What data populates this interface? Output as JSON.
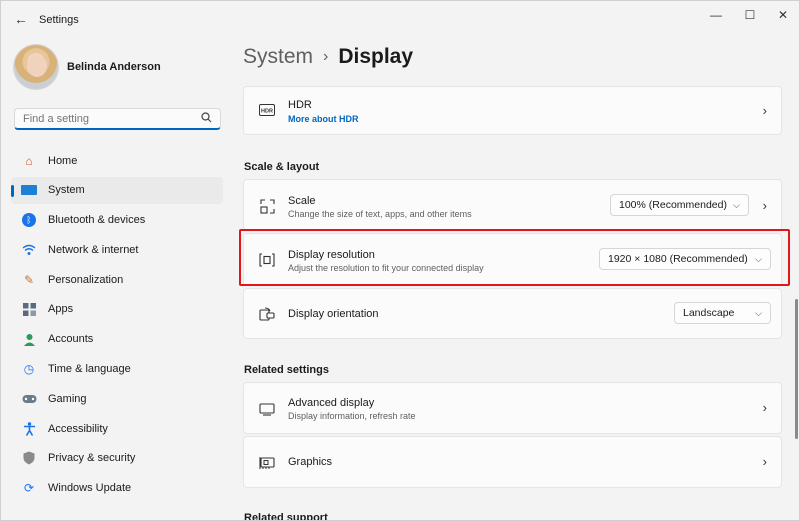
{
  "window": {
    "app_title": "Settings",
    "back_glyph": "←",
    "minimize_glyph": "—",
    "maximize_glyph": "☐",
    "close_glyph": "✕"
  },
  "profile": {
    "name": "Belinda Anderson"
  },
  "search": {
    "placeholder": "Find a setting",
    "icon": "search-icon"
  },
  "sidebar": {
    "items": [
      {
        "label": "Home",
        "icon": "home-icon"
      },
      {
        "label": "System",
        "icon": "system-icon",
        "active": true
      },
      {
        "label": "Bluetooth & devices",
        "icon": "bluetooth-icon"
      },
      {
        "label": "Network & internet",
        "icon": "wifi-icon"
      },
      {
        "label": "Personalization",
        "icon": "brush-icon"
      },
      {
        "label": "Apps",
        "icon": "apps-icon"
      },
      {
        "label": "Accounts",
        "icon": "accounts-icon"
      },
      {
        "label": "Time & language",
        "icon": "clock-globe-icon"
      },
      {
        "label": "Gaming",
        "icon": "gamepad-icon"
      },
      {
        "label": "Accessibility",
        "icon": "accessibility-icon"
      },
      {
        "label": "Privacy & security",
        "icon": "shield-icon"
      },
      {
        "label": "Windows Update",
        "icon": "update-icon"
      }
    ]
  },
  "breadcrumb": {
    "parent": "System",
    "separator": "›",
    "current": "Display"
  },
  "hdr": {
    "title": "HDR",
    "link": "More about HDR"
  },
  "scale_layout": {
    "section_title": "Scale & layout",
    "scale": {
      "title": "Scale",
      "subtitle": "Change the size of text, apps, and other items",
      "value": "100% (Recommended)"
    },
    "resolution": {
      "title": "Display resolution",
      "subtitle": "Adjust the resolution to fit your connected display",
      "value": "1920 × 1080 (Recommended)"
    },
    "orientation": {
      "title": "Display orientation",
      "value": "Landscape"
    }
  },
  "related_settings": {
    "section_title": "Related settings",
    "advanced": {
      "title": "Advanced display",
      "subtitle": "Display information, refresh rate"
    },
    "graphics": {
      "title": "Graphics"
    }
  },
  "related_support": {
    "section_title": "Related support"
  },
  "colors": {
    "accent": "#0067c0",
    "highlight_border": "#e0161b"
  }
}
